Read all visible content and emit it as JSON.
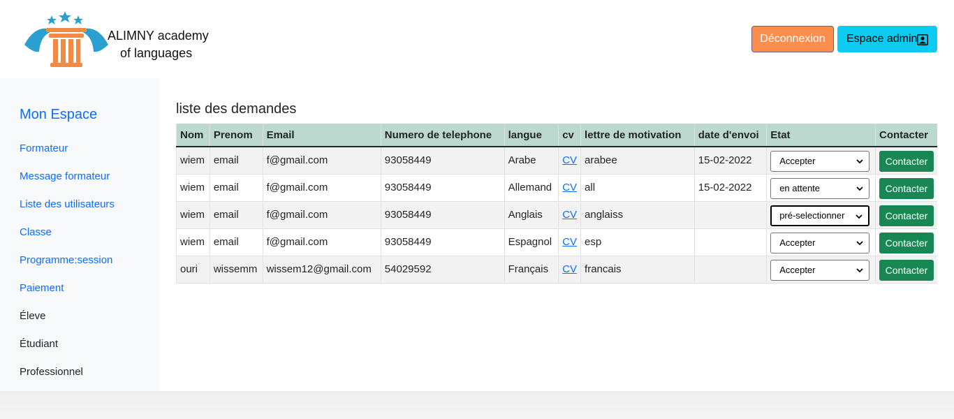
{
  "brand": {
    "line1": "ALIMNY academy",
    "line2": "of languages"
  },
  "header": {
    "logout_label": "Déconnexion",
    "admin_label": "Espace admin",
    "admin_icon": "person-badge-icon"
  },
  "sidebar": {
    "title": "Mon Espace",
    "links": [
      "Formateur",
      "Message formateur",
      "Liste des utilisateurs",
      "Classe",
      "Programme:session",
      "Paiement"
    ],
    "plain": [
      "Éleve",
      "Étudiant",
      "Professionnel"
    ]
  },
  "main": {
    "title": "liste des demandes",
    "columns": [
      "Nom",
      "Prenom",
      "Email",
      "Numero de telephone",
      "langue",
      "cv",
      "lettre de motivation",
      "date d'envoi",
      "Etat",
      "Contacter"
    ],
    "rows": [
      {
        "nom": "wiem",
        "prenom": "email",
        "email": "f@gmail.com",
        "tel": "93058449",
        "langue": "Arabe",
        "cv": "CV",
        "lettre": "arabee",
        "date": "15-02-2022",
        "etat": "Accepter",
        "contact": "Contacter"
      },
      {
        "nom": "wiem",
        "prenom": "email",
        "email": "f@gmail.com",
        "tel": "93058449",
        "langue": "Allemand",
        "cv": "CV",
        "lettre": "all",
        "date": "15-02-2022",
        "etat": "en attente",
        "contact": "Contacter"
      },
      {
        "nom": "wiem",
        "prenom": "email",
        "email": "f@gmail.com",
        "tel": "93058449",
        "langue": "Anglais",
        "cv": "CV",
        "lettre": "anglaiss",
        "date": "",
        "etat": "pré-selectionner",
        "contact": "Contacter"
      },
      {
        "nom": "wiem",
        "prenom": "email",
        "email": "f@gmail.com",
        "tel": "93058449",
        "langue": "Espagnol",
        "cv": "CV",
        "lettre": "esp",
        "date": "",
        "etat": "Accepter",
        "contact": "Contacter"
      },
      {
        "nom": "ouri",
        "prenom": "wissemm",
        "email": "wissem12@gmail.com",
        "tel": "54029592",
        "langue": "Français",
        "cv": "CV",
        "lettre": "francais",
        "date": "",
        "etat": "Accepter",
        "contact": "Contacter"
      }
    ]
  },
  "colors": {
    "primary": "#0d6efd",
    "logout": "#fd8e4d",
    "admin": "#0dcaf0",
    "contact": "#198754",
    "table_head": "#bcd9cf"
  }
}
